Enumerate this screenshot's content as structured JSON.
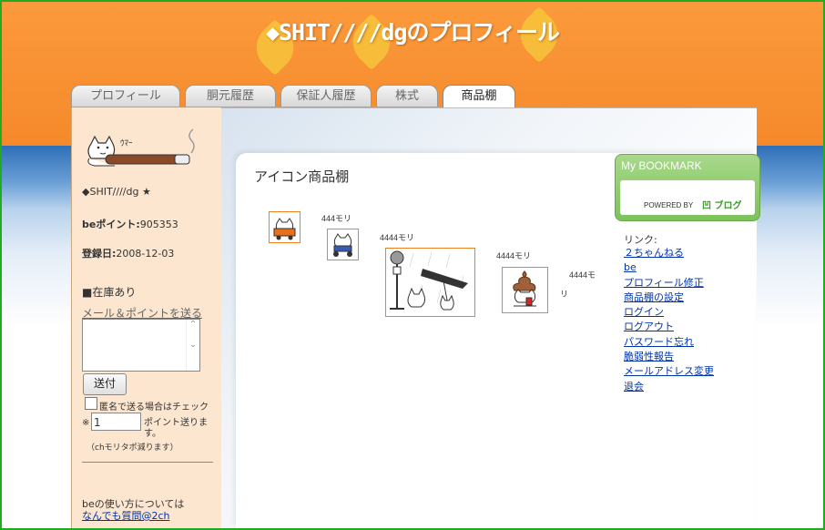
{
  "header": {
    "title": "◆SHIT////dgのプロフィール"
  },
  "tabs": [
    {
      "label": "プロフィール"
    },
    {
      "label": "胴元履歴"
    },
    {
      "label": "保証人履歴"
    },
    {
      "label": "株式"
    },
    {
      "label": "商品棚"
    }
  ],
  "sidebar": {
    "avatar_caption": "ｳﾏｰ",
    "username": "◆SHIT////dg ★",
    "be_points_label": "beポイント:",
    "be_points_value": "905353",
    "registered_label": "登録日:",
    "registered_value": "2008-12-03",
    "stock_status": "■在庫あり",
    "send_mail_link": "メール＆ポイントを送る",
    "send_button": "送付",
    "anonymous_label": "匿名で送る場合はチェック",
    "points_prefix": "※",
    "points_value": "1",
    "points_suffix": "ポイント送ります。",
    "points_note": "（chモリタポ減ります）",
    "help_text": "beの使い方については",
    "help_link": "なんでも質問@2ch"
  },
  "shelf": {
    "title": "アイコン商品棚",
    "items": [
      {
        "price": ""
      },
      {
        "price": "444モリ"
      },
      {
        "price": "4444モリ"
      },
      {
        "price": "4444モリ"
      },
      {
        "price": "4444モ"
      }
    ],
    "extra_fragment": "リ"
  },
  "bookmark": {
    "title": "My BOOKMARK",
    "powered_by": "POWERED BY",
    "brand": "ブログ"
  },
  "links": {
    "heading": "リンク:",
    "items": [
      "２ちゃんねる",
      "be",
      "プロフィール修正",
      "商品棚の設定",
      "ログイン",
      "ログアウト",
      "パスワード忘れ",
      "脆弱性報告",
      "メールアドレス変更",
      "退会"
    ]
  },
  "colors": {
    "header_orange": "#f5892a",
    "sidebar_peach": "#fce6cf",
    "bookmark_green": "#7cc25a",
    "link_blue": "#0033aa",
    "frame_green": "#22aa22"
  }
}
